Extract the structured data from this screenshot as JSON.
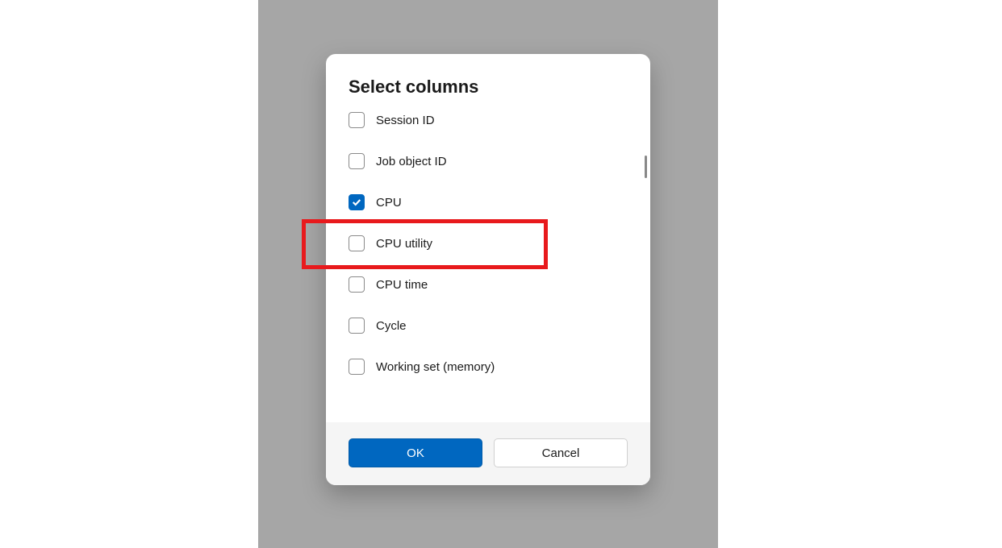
{
  "dialog": {
    "title": "Select columns",
    "options": [
      {
        "label": "Session ID",
        "checked": false
      },
      {
        "label": "Job object ID",
        "checked": false
      },
      {
        "label": "CPU",
        "checked": true
      },
      {
        "label": "CPU utility",
        "checked": false
      },
      {
        "label": "CPU time",
        "checked": false
      },
      {
        "label": "Cycle",
        "checked": false
      },
      {
        "label": "Working set (memory)",
        "checked": false
      }
    ],
    "buttons": {
      "ok": "OK",
      "cancel": "Cancel"
    }
  },
  "highlight": {
    "target_option": "CPU utility"
  }
}
